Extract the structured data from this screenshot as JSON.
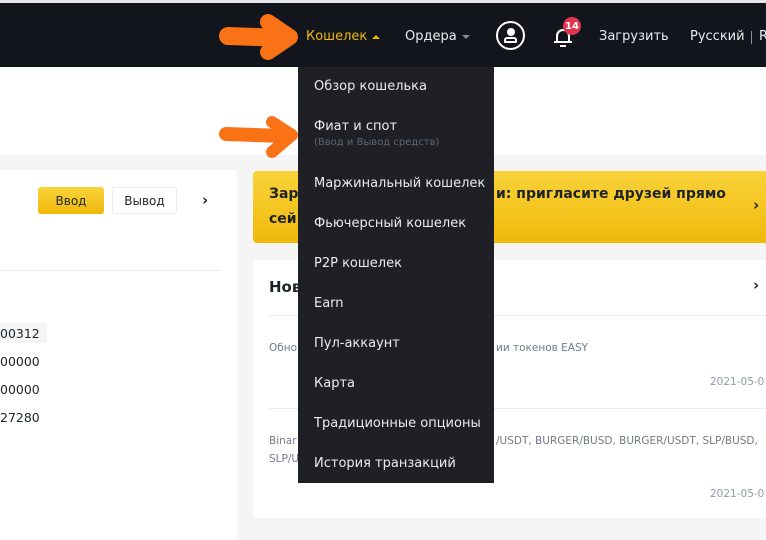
{
  "header": {
    "wallet_label": "Кошелек",
    "orders_label": "Ордера",
    "notification_count": "14",
    "download_label": "Загрузить",
    "language_label": "Русский",
    "currency_partial": "R",
    "accent": "#f0b90b"
  },
  "left_card": {
    "deposit_label": "Ввод",
    "withdraw_label": "Вывод",
    "values": [
      "00312",
      "00000",
      "00000",
      "27280"
    ]
  },
  "banner": {
    "text_left_1": "Зар",
    "text_left_2": "сей",
    "text_right": "и: пригласите друзей прямо"
  },
  "news": {
    "title_partial": "Нов",
    "items": [
      {
        "left": "Обно",
        "right": "ии токенов EASY",
        "date": "2021-05-0"
      },
      {
        "left": "Binar",
        "left2": "SLP/U",
        "right": "/USDT, BURGER/BUSD, BURGER/USDT, SLP/BUSD,",
        "date": "2021-05-0"
      }
    ]
  },
  "wallet_menu": {
    "items": [
      {
        "label": "Обзор кошелька"
      },
      {
        "label": "Фиат и спот",
        "sub": "(Ввод и Вывод средств)"
      },
      {
        "label": "Маржинальный кошелек"
      },
      {
        "label": "Фьючерсный кошелек"
      },
      {
        "label": "P2P кошелек"
      },
      {
        "label": "Earn"
      },
      {
        "label": "Пул-аккаунт"
      },
      {
        "label": "Карта"
      },
      {
        "label": "Традиционные опционы"
      },
      {
        "label": "История транзакций"
      }
    ]
  }
}
